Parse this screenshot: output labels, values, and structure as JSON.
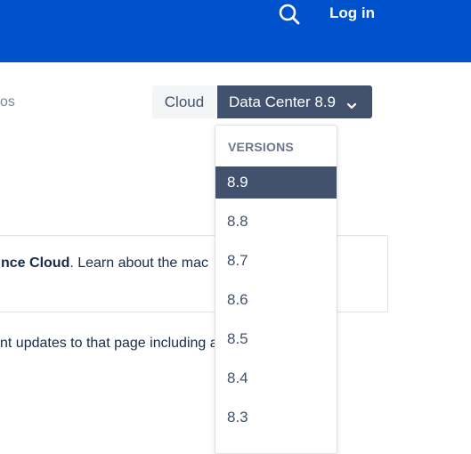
{
  "header": {
    "login_label": "Log in",
    "search_icon": "search-icon",
    "background": "#0052cc"
  },
  "breadcrumb_fragment": "os",
  "version_switcher": {
    "cloud_label": "Cloud",
    "datacenter_label": "Data Center 8.9",
    "chevron_icon": "chevron-down-icon"
  },
  "dropdown": {
    "header": "VERSIONS",
    "items": [
      "8.9",
      "8.8",
      "8.7",
      "8.6",
      "8.5",
      "8.4",
      "8.3"
    ],
    "selected": "8.9"
  },
  "notice": {
    "bold_text": "nce Cloud",
    "text": ". Learn about the mac"
  },
  "body_text": "nt updates to that page including                          author,"
}
